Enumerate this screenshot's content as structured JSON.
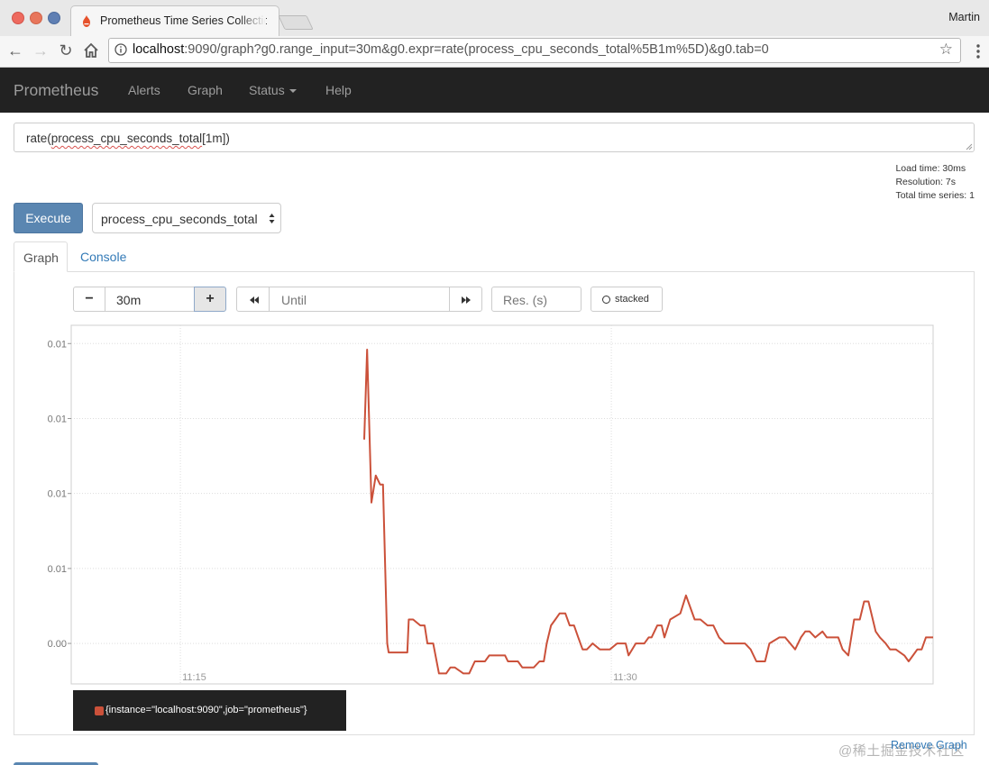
{
  "browser": {
    "tab_title": "Prometheus Time Series Collection and Processing Server",
    "profile": "Martin",
    "url_host": "localhost",
    "url_rest": ":9090/graph?g0.range_input=30m&g0.expr=rate(process_cpu_seconds_total%5B1m%5D)&g0.tab=0"
  },
  "nav": {
    "brand": "Prometheus",
    "alerts": "Alerts",
    "graph": "Graph",
    "status": "Status",
    "help": "Help"
  },
  "query": {
    "expr_prefix": "rate(",
    "expr_metric": "process_cpu_seconds_total",
    "expr_suffix": "[1m])"
  },
  "stats": {
    "load_time": "Load time: 30ms",
    "resolution": "Resolution: 7s",
    "total_series": "Total time series: 1"
  },
  "controls": {
    "execute": "Execute",
    "metric_select": "process_cpu_seconds_total",
    "tab_graph": "Graph",
    "tab_console": "Console",
    "minus": "−",
    "range": "30m",
    "plus": "+",
    "until_placeholder": "Until",
    "res_placeholder": "Res. (s)",
    "stacked": "stacked",
    "remove_graph": "Remove Graph"
  },
  "legend": {
    "series": "{instance=\"localhost:9090\",job=\"prometheus\"}"
  },
  "colors": {
    "series": "#cb513a",
    "navbar": "#222222",
    "execute": "#5a86b1",
    "link": "#337ab7"
  },
  "watermark": "@稀土掘金技术社区",
  "chart_data": {
    "type": "line",
    "y_tick_labels": [
      "0.01",
      "0.01",
      "0.01",
      "0.01",
      "0.00"
    ],
    "x_tick_labels": [
      "11:15",
      "11:30"
    ],
    "x_tick_minutes": [
      15,
      30
    ],
    "x_range_minutes": [
      11.2,
      41.2
    ],
    "y_tick_values": [
      0.018,
      0.0155,
      0.013,
      0.0105,
      0.008
    ],
    "ylim": [
      0.00665,
      0.01861
    ],
    "grid": true,
    "series": [
      {
        "name": "{instance=\"localhost:9090\",job=\"prometheus\"}",
        "x": [
          21.4,
          21.5,
          21.65,
          21.8,
          21.95,
          22.05,
          22.2,
          22.25,
          22.55,
          22.9,
          22.95,
          23.1,
          23.35,
          23.5,
          23.6,
          23.8,
          24.0,
          24.25,
          24.4,
          24.55,
          24.85,
          25.05,
          25.25,
          25.6,
          25.75,
          25.9,
          26.0,
          26.3,
          26.4,
          26.75,
          26.9,
          27.3,
          27.5,
          27.65,
          27.75,
          27.9,
          28.05,
          28.2,
          28.4,
          28.55,
          28.7,
          28.85,
          29.0,
          29.15,
          29.35,
          29.6,
          29.75,
          29.95,
          30.2,
          30.35,
          30.5,
          30.6,
          30.85,
          31.0,
          31.15,
          31.3,
          31.4,
          31.6,
          31.75,
          31.85,
          32.05,
          32.4,
          32.6,
          32.9,
          33.1,
          33.35,
          33.55,
          33.75,
          33.95,
          34.5,
          34.65,
          34.85,
          35.05,
          35.35,
          35.5,
          35.85,
          36.05,
          36.4,
          36.6,
          36.75,
          36.9,
          37.1,
          37.35,
          37.5,
          37.75,
          37.9,
          38.05,
          38.25,
          38.45,
          38.65,
          38.8,
          38.95,
          39.2,
          39.35,
          39.55,
          39.7,
          39.9,
          40.2,
          40.35,
          40.5,
          40.65,
          40.8,
          40.95,
          41.2
        ],
        "y": [
          0.0148,
          0.0178,
          0.0127,
          0.0136,
          0.0133,
          0.0133,
          0.008,
          0.0077,
          0.0077,
          0.0077,
          0.0088,
          0.0088,
          0.0086,
          0.0086,
          0.008,
          0.008,
          0.007,
          0.007,
          0.0072,
          0.0072,
          0.007,
          0.007,
          0.0074,
          0.0074,
          0.0076,
          0.0076,
          0.0076,
          0.0076,
          0.0074,
          0.0074,
          0.0072,
          0.0072,
          0.0074,
          0.0074,
          0.008,
          0.0086,
          0.0088,
          0.009,
          0.009,
          0.0086,
          0.0086,
          0.0082,
          0.0078,
          0.0078,
          0.008,
          0.0078,
          0.0078,
          0.0078,
          0.008,
          0.008,
          0.008,
          0.0076,
          0.008,
          0.008,
          0.008,
          0.0082,
          0.0082,
          0.0086,
          0.0086,
          0.0082,
          0.0088,
          0.009,
          0.0096,
          0.0088,
          0.0088,
          0.0086,
          0.0086,
          0.0082,
          0.008,
          0.008,
          0.008,
          0.0078,
          0.0074,
          0.0074,
          0.008,
          0.0082,
          0.0082,
          0.0078,
          0.0082,
          0.0084,
          0.0084,
          0.0082,
          0.0084,
          0.0082,
          0.0082,
          0.0082,
          0.0078,
          0.0076,
          0.0088,
          0.0088,
          0.0094,
          0.0094,
          0.0084,
          0.0082,
          0.008,
          0.0078,
          0.0078,
          0.0076,
          0.0074,
          0.0076,
          0.0078,
          0.0078,
          0.0082,
          0.0082
        ]
      }
    ]
  }
}
